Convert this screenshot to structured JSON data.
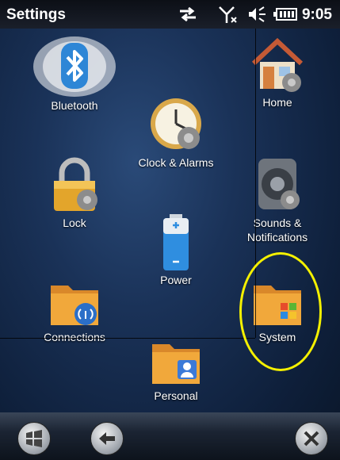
{
  "statusbar": {
    "title": "Settings",
    "time": "9:05",
    "icons": [
      "sync-arrows-icon",
      "no-signal-icon",
      "volume-icon",
      "battery-icon"
    ]
  },
  "tiles": {
    "bluetooth": "Bluetooth",
    "clock": "Clock & Alarms",
    "home": "Home",
    "lock": "Lock",
    "sounds_line1": "Sounds &",
    "sounds_line2": "Notifications",
    "power": "Power",
    "connections": "Connections",
    "system": "System",
    "personal": "Personal"
  },
  "bottombar": {
    "icons": [
      "windows-start-icon",
      "back-arrow-icon",
      "close-icon"
    ]
  },
  "highlight_color": "#f4f000"
}
